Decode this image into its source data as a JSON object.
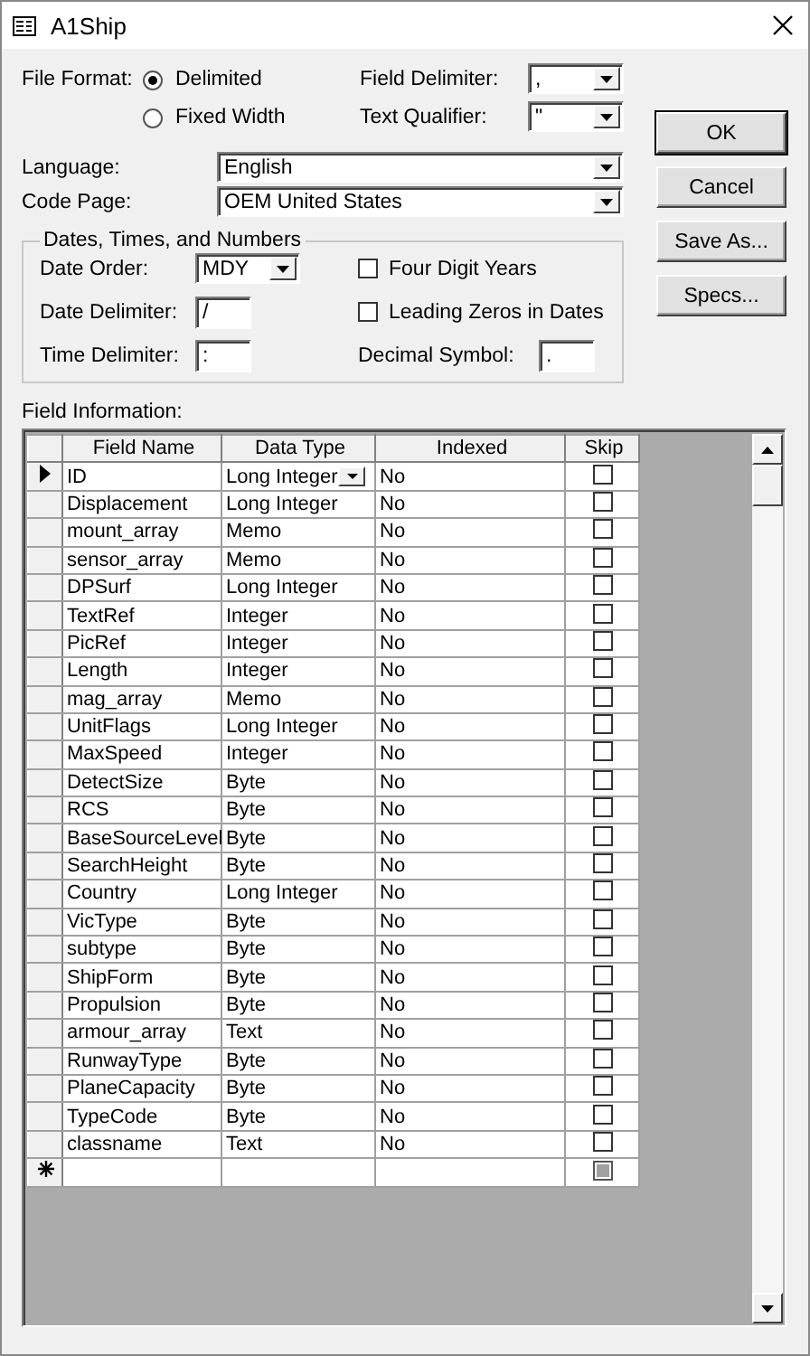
{
  "window": {
    "title": "A1Ship"
  },
  "file_format": {
    "label": "File Format:",
    "options": [
      {
        "label": "Delimited",
        "selected": true
      },
      {
        "label": "Fixed Width",
        "selected": false
      }
    ]
  },
  "field_delimiter": {
    "label": "Field Delimiter:",
    "value": ","
  },
  "text_qualifier": {
    "label": "Text Qualifier:",
    "value": "\""
  },
  "language": {
    "label": "Language:",
    "value": "English"
  },
  "code_page": {
    "label": "Code Page:",
    "value": "OEM United States"
  },
  "dates_group": {
    "title": "Dates, Times, and Numbers",
    "date_order": {
      "label": "Date Order:",
      "value": "MDY"
    },
    "date_delimiter": {
      "label": "Date Delimiter:",
      "value": "/"
    },
    "time_delimiter": {
      "label": "Time Delimiter:",
      "value": ":"
    },
    "four_digit_years": {
      "label": "Four Digit Years",
      "checked": false
    },
    "leading_zeros": {
      "label": "Leading Zeros in Dates",
      "checked": false
    },
    "decimal_symbol": {
      "label": "Decimal Symbol:",
      "value": "."
    }
  },
  "buttons": [
    {
      "label": "OK",
      "default": true
    },
    {
      "label": "Cancel",
      "default": false
    },
    {
      "label": "Save As...",
      "default": false
    },
    {
      "label": "Specs...",
      "default": false
    }
  ],
  "field_information": {
    "label": "Field Information:",
    "columns": [
      "Field Name",
      "Data Type",
      "Indexed",
      "Skip"
    ],
    "rows": [
      {
        "field_name": "ID",
        "data_type": "Long Integer",
        "indexed": "No",
        "skip": false,
        "selected": true
      },
      {
        "field_name": "Displacement",
        "data_type": "Long Integer",
        "indexed": "No",
        "skip": false,
        "selected": false
      },
      {
        "field_name": "mount_array",
        "data_type": "Memo",
        "indexed": "No",
        "skip": false,
        "selected": false
      },
      {
        "field_name": "sensor_array",
        "data_type": "Memo",
        "indexed": "No",
        "skip": false,
        "selected": false
      },
      {
        "field_name": "DPSurf",
        "data_type": "Long Integer",
        "indexed": "No",
        "skip": false,
        "selected": false
      },
      {
        "field_name": "TextRef",
        "data_type": "Integer",
        "indexed": "No",
        "skip": false,
        "selected": false
      },
      {
        "field_name": "PicRef",
        "data_type": "Integer",
        "indexed": "No",
        "skip": false,
        "selected": false
      },
      {
        "field_name": "Length",
        "data_type": "Integer",
        "indexed": "No",
        "skip": false,
        "selected": false
      },
      {
        "field_name": "mag_array",
        "data_type": "Memo",
        "indexed": "No",
        "skip": false,
        "selected": false
      },
      {
        "field_name": "UnitFlags",
        "data_type": "Long Integer",
        "indexed": "No",
        "skip": false,
        "selected": false
      },
      {
        "field_name": "MaxSpeed",
        "data_type": "Integer",
        "indexed": "No",
        "skip": false,
        "selected": false
      },
      {
        "field_name": "DetectSize",
        "data_type": "Byte",
        "indexed": "No",
        "skip": false,
        "selected": false
      },
      {
        "field_name": "RCS",
        "data_type": "Byte",
        "indexed": "No",
        "skip": false,
        "selected": false
      },
      {
        "field_name": "BaseSourceLevel",
        "data_type": "Byte",
        "indexed": "No",
        "skip": false,
        "selected": false
      },
      {
        "field_name": "SearchHeight",
        "data_type": "Byte",
        "indexed": "No",
        "skip": false,
        "selected": false
      },
      {
        "field_name": "Country",
        "data_type": "Long Integer",
        "indexed": "No",
        "skip": false,
        "selected": false
      },
      {
        "field_name": "VicType",
        "data_type": "Byte",
        "indexed": "No",
        "skip": false,
        "selected": false
      },
      {
        "field_name": "subtype",
        "data_type": "Byte",
        "indexed": "No",
        "skip": false,
        "selected": false
      },
      {
        "field_name": "ShipForm",
        "data_type": "Byte",
        "indexed": "No",
        "skip": false,
        "selected": false
      },
      {
        "field_name": "Propulsion",
        "data_type": "Byte",
        "indexed": "No",
        "skip": false,
        "selected": false
      },
      {
        "field_name": "armour_array",
        "data_type": "Text",
        "indexed": "No",
        "skip": false,
        "selected": false
      },
      {
        "field_name": "RunwayType",
        "data_type": "Byte",
        "indexed": "No",
        "skip": false,
        "selected": false
      },
      {
        "field_name": "PlaneCapacity",
        "data_type": "Byte",
        "indexed": "No",
        "skip": false,
        "selected": false
      },
      {
        "field_name": "TypeCode",
        "data_type": "Byte",
        "indexed": "No",
        "skip": false,
        "selected": false
      },
      {
        "field_name": "classname",
        "data_type": "Text",
        "indexed": "No",
        "skip": false,
        "selected": false
      }
    ],
    "new_row": {
      "skip_disabled": true
    }
  }
}
